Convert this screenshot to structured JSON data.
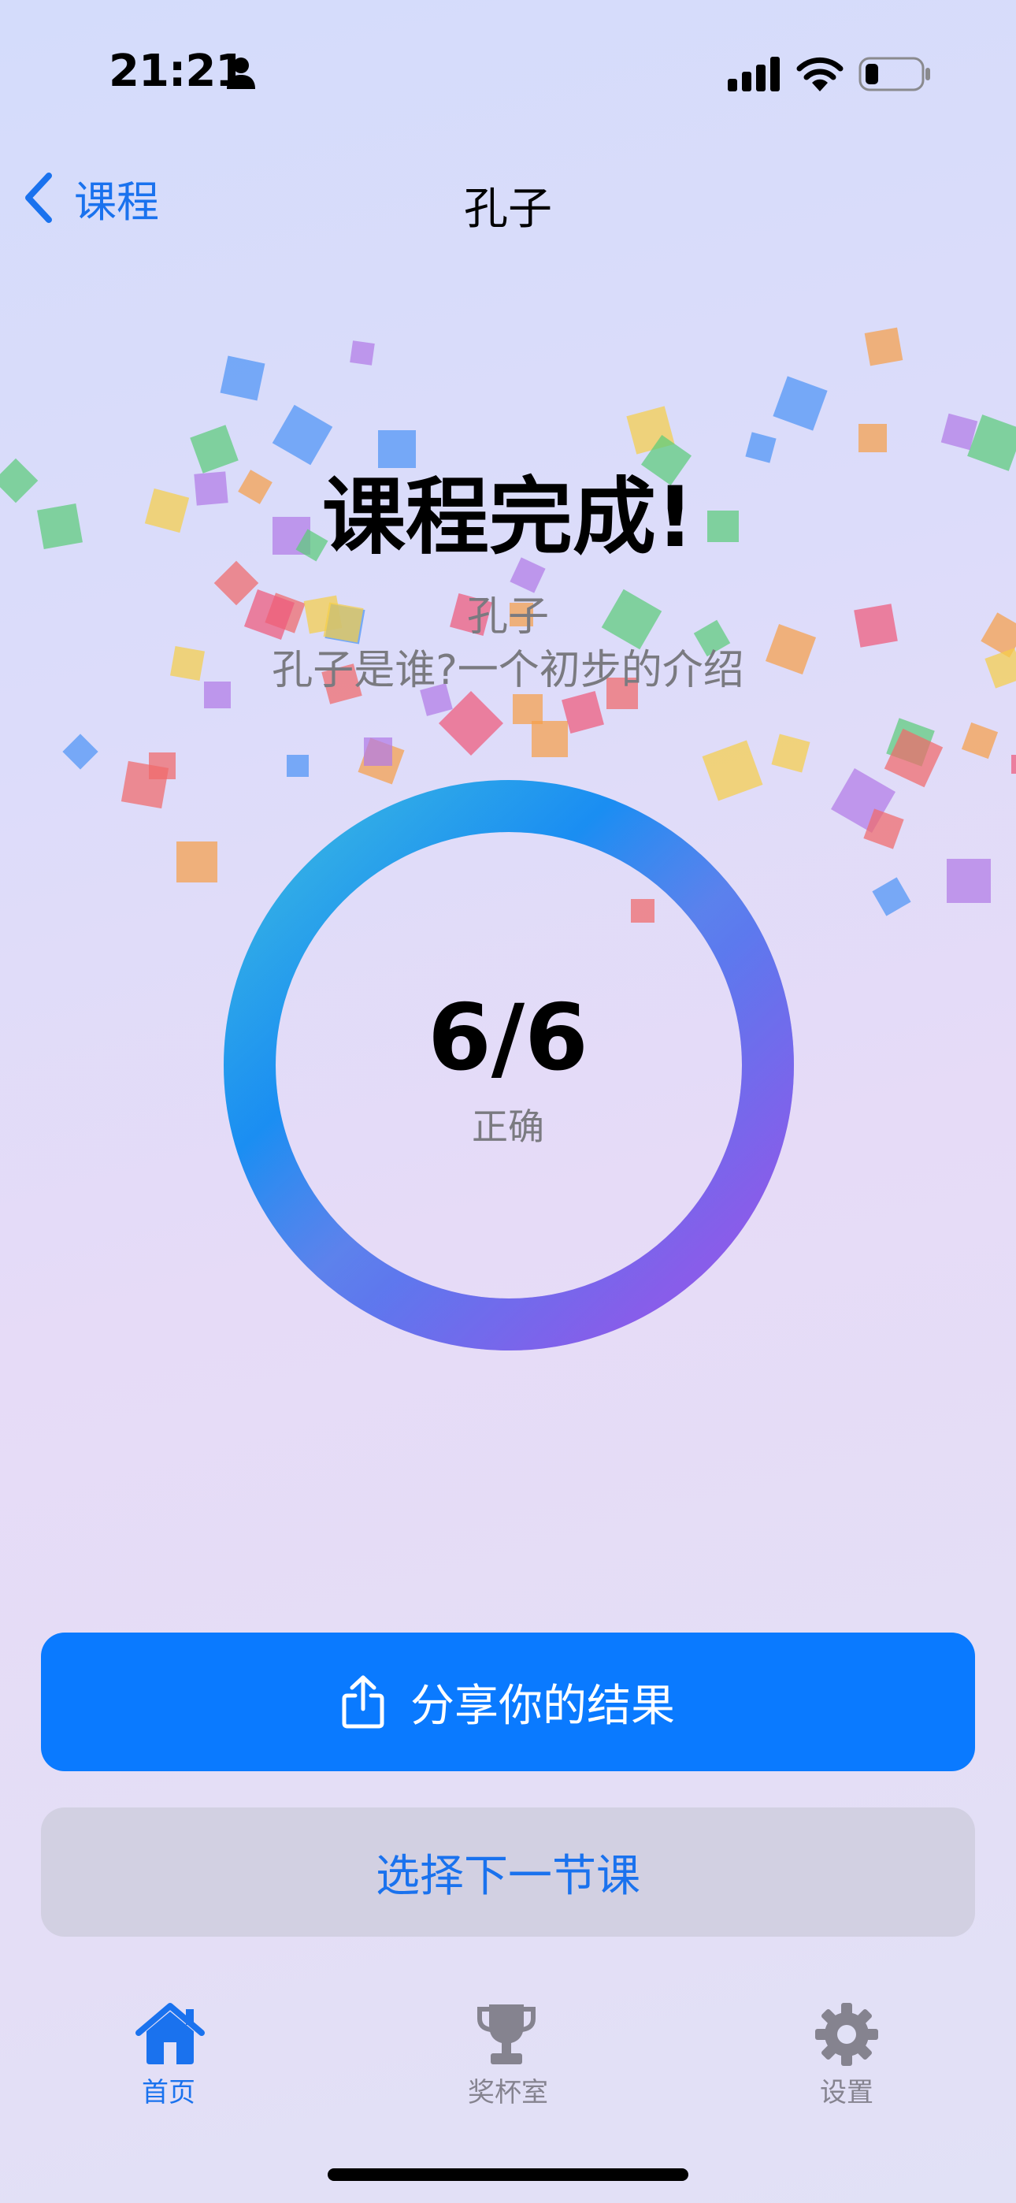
{
  "status_bar": {
    "time": "21:21"
  },
  "nav": {
    "back_label": "课程",
    "title": "孔子"
  },
  "completion": {
    "title": "课程完成!",
    "lesson_name": "孔子",
    "lesson_subtitle": "孔子是谁?一个初步的介绍"
  },
  "score": {
    "value": "6/6",
    "label": "正确",
    "correct": 6,
    "total": 6
  },
  "actions": {
    "share_label": "分享你的结果",
    "next_label": "选择下一节课"
  },
  "tabs": [
    {
      "label": "首页",
      "icon": "house-icon",
      "active": true
    },
    {
      "label": "奖杯室",
      "icon": "trophy-icon",
      "active": false
    },
    {
      "label": "设置",
      "icon": "gear-icon",
      "active": false
    }
  ],
  "colors": {
    "accent": "#0a7aff",
    "link": "#1a72ee",
    "secondary_text": "#7a7a80",
    "ring_start": "#b150e2",
    "ring_end": "#0a7aff",
    "ring_top": "#32ade6"
  }
}
